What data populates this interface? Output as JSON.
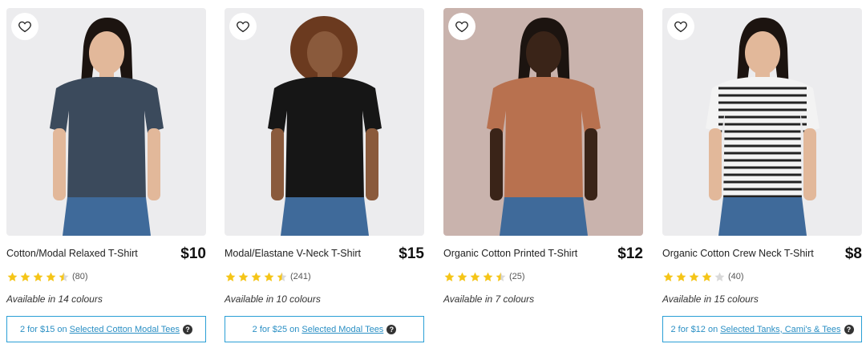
{
  "products": [
    {
      "name": "Cotton/Modal Relaxed T-Shirt",
      "price": "$10",
      "rating": 4.5,
      "review_count": "(80)",
      "availability": "Available in 14 colours",
      "promo_prefix": "2 for $15 on",
      "promo_link": "Selected Cotton Modal Tees",
      "shirt_color": "#3b4a5c",
      "image_alt": "Model wearing navy relaxed t-shirt and jeans"
    },
    {
      "name": "Modal/Elastane V-Neck T-Shirt",
      "price": "$15",
      "rating": 4.5,
      "review_count": "(241)",
      "availability": "Available in 10 colours",
      "promo_prefix": "2 for $25 on",
      "promo_link": "Selected Modal Tees",
      "shirt_color": "#161616",
      "image_alt": "Model wearing black v-neck t-shirt and jeans"
    },
    {
      "name": "Organic Cotton Printed T-Shirt",
      "price": "$12",
      "rating": 4.5,
      "review_count": "(25)",
      "availability": "Available in 7 colours",
      "promo_prefix": "",
      "promo_link": "",
      "shirt_color": "#b8714f",
      "image_alt": "Model wearing rust printed t-shirt and jeans"
    },
    {
      "name": "Organic Cotton Crew Neck T-Shirt",
      "price": "$8",
      "rating": 4,
      "review_count": "(40)",
      "availability": "Available in 15 colours",
      "promo_prefix": "2 for $12 on",
      "promo_link": "Selected Tanks, Cami's & Tees",
      "shirt_color": "#f3f3f3",
      "image_alt": "Model wearing striped crew neck t-shirt and jeans"
    }
  ],
  "icons": {
    "wishlist": "heart-outline-icon",
    "star": "star-icon",
    "help": "question-circle-icon",
    "help_glyph": "?"
  },
  "colors": {
    "star_fill": "#f5c518",
    "star_empty": "#d9d9d9",
    "promo_border": "#2a9fd6",
    "promo_text": "#2a8fc4",
    "denim": "#3f6a9a"
  }
}
